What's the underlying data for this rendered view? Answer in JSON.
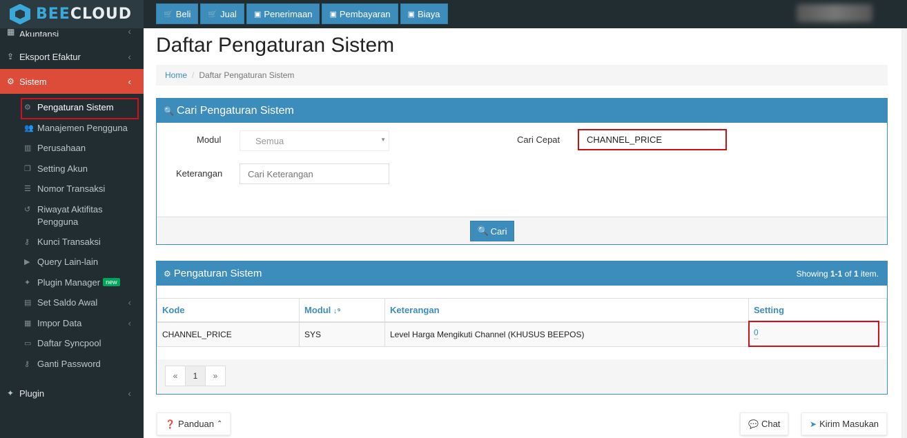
{
  "brand": {
    "name_bee": "BEE",
    "name_cloud": "CLOUD"
  },
  "topnav": [
    {
      "label": "Beli",
      "icon": "cart-icon"
    },
    {
      "label": "Jual",
      "icon": "cart-icon"
    },
    {
      "label": "Penerimaan",
      "icon": "money-icon"
    },
    {
      "label": "Pembayaran",
      "icon": "money-icon"
    },
    {
      "label": "Biaya",
      "icon": "money-icon"
    }
  ],
  "sidebar": {
    "akuntansi": "Akuntansi",
    "eksport": "Eksport Efaktur",
    "sistem": "Sistem",
    "sub": [
      {
        "label": "Pengaturan Sistem",
        "icon": "gear-icon"
      },
      {
        "label": "Manajemen Pengguna",
        "icon": "users-icon"
      },
      {
        "label": "Perusahaan",
        "icon": "building-icon"
      },
      {
        "label": "Setting Akun",
        "icon": "copy-icon"
      },
      {
        "label": "Nomor Transaksi",
        "icon": "list-icon"
      },
      {
        "label": "Riwayat Aktifitas Pengguna",
        "icon": "history-icon"
      },
      {
        "label": "Kunci Transaksi",
        "icon": "key-icon"
      },
      {
        "label": "Query Lain-lain",
        "icon": "play-icon"
      },
      {
        "label": "Plugin Manager",
        "icon": "puzzle-icon",
        "badge": "new"
      },
      {
        "label": "Set Saldo Awal",
        "icon": "calc-icon"
      },
      {
        "label": "Impor Data",
        "icon": "table-icon"
      },
      {
        "label": "Daftar Syncpool",
        "icon": "window-icon"
      },
      {
        "label": "Ganti Password",
        "icon": "key-icon"
      }
    ],
    "plugin": "Plugin"
  },
  "page": {
    "title": "Daftar Pengaturan Sistem",
    "breadcrumb_home": "Home",
    "breadcrumb_current": "Daftar Pengaturan Sistem"
  },
  "search": {
    "title": "Cari Pengaturan Sistem",
    "modul_label": "Modul",
    "modul_value": "Semua",
    "keterangan_label": "Keterangan",
    "keterangan_placeholder": "Cari Keterangan",
    "cari_cepat_label": "Cari Cepat",
    "cari_cepat_value": "CHANNEL_PRICE",
    "button": "Cari"
  },
  "results": {
    "title": "Pengaturan Sistem",
    "summary_prefix": "Showing ",
    "summary_range": "1-1",
    "summary_mid": " of ",
    "summary_total": "1",
    "summary_suffix": " item.",
    "columns": [
      "Kode",
      "Modul",
      "Keterangan",
      "Setting"
    ],
    "rows": [
      {
        "kode": "CHANNEL_PRICE",
        "modul": "SYS",
        "keterangan": "Level Harga Mengikuti Channel (KHUSUS BEEPOS)",
        "setting": "0",
        "setting_sub": "--"
      }
    ],
    "pager": [
      "«",
      "1",
      "»"
    ]
  },
  "footer": {
    "panduan": "Panduan",
    "chat": "Chat",
    "kirim": "Kirim Masukan"
  }
}
